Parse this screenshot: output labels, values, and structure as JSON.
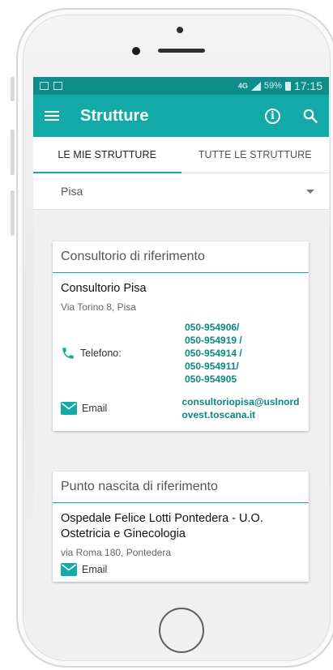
{
  "status_bar": {
    "network": "4G",
    "battery": "59%",
    "time": "17:15"
  },
  "app_bar": {
    "title": "Strutture"
  },
  "tabs": [
    {
      "label": "LE MIE STRUTTURE"
    },
    {
      "label": "TUTTE LE STRUTTURE"
    }
  ],
  "filter": {
    "selected": "Pisa"
  },
  "cards": [
    {
      "header": "Consultorio di riferimento",
      "name": "Consultorio Pisa",
      "address": "Via Torino 8, Pisa",
      "phone_label": "Telefono:",
      "phones": [
        "050-954906/",
        "050-954919 /",
        "050-954914 /",
        "050-954911/",
        "050-954905"
      ],
      "email_label": "Email",
      "email": "consultoriopisa@uslnordovest.toscana.it"
    },
    {
      "header": "Punto nascita di riferimento",
      "name": "Ospedale Felice Lotti Pontedera - U.O. Ostetricia e Ginecologia",
      "address": "via Roma 180, Pontedera",
      "email_label": "Email"
    }
  ],
  "colors": {
    "accent": "#12aaa6",
    "status_bar": "#0d8e8b",
    "link": "#0e8683"
  }
}
